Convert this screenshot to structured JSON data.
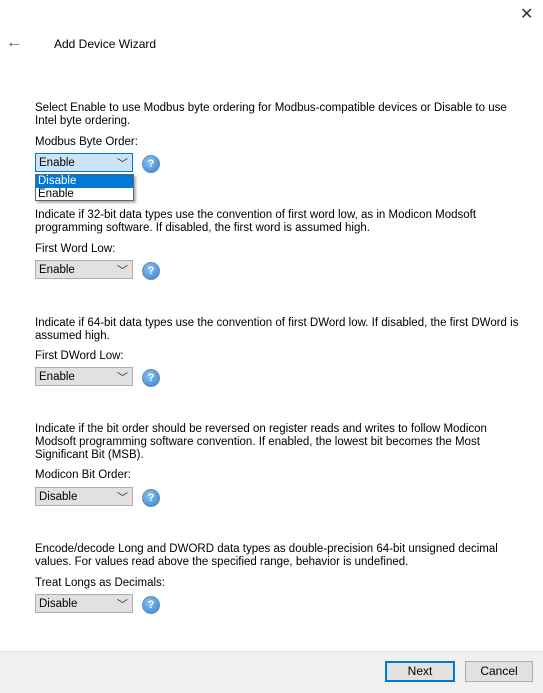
{
  "window": {
    "title": "Add Device Wizard",
    "back_icon": "arrow-left-icon",
    "close_icon": "close-icon"
  },
  "sections": [
    {
      "description": "Select Enable to use Modbus byte ordering for Modbus-compatible devices or Disable to use Intel byte ordering.",
      "label": "Modbus Byte Order:",
      "value": "Enable",
      "open": true,
      "options": [
        "Disable",
        "Enable"
      ],
      "highlighted": "Disable"
    },
    {
      "description": "Indicate if 32-bit data types use the convention of first word low, as in Modicon Modsoft programming software. If disabled, the first word is assumed high.",
      "label": "First Word Low:",
      "value": "Enable"
    },
    {
      "description": "Indicate if 64-bit data types use the convention of first DWord low. If disabled, the first DWord is assumed high.",
      "label": "First DWord Low:",
      "value": "Enable"
    },
    {
      "description": "Indicate if the bit order should be reversed on register reads and writes to follow Modicon Modsoft programming software convention. If enabled, the lowest bit becomes the Most Significant Bit (MSB).",
      "label": "Modicon Bit Order:",
      "value": "Disable"
    },
    {
      "description": "Encode/decode Long and DWORD data types as double-precision 64-bit unsigned decimal values. For values read above the specified range, behavior is undefined.",
      "label": "Treat Longs as Decimals:",
      "value": "Disable"
    }
  ],
  "help_glyph": "?",
  "footer": {
    "next": "Next",
    "cancel": "Cancel"
  },
  "colors": {
    "accent": "#0078d7",
    "footer": "#f0f0f0"
  }
}
